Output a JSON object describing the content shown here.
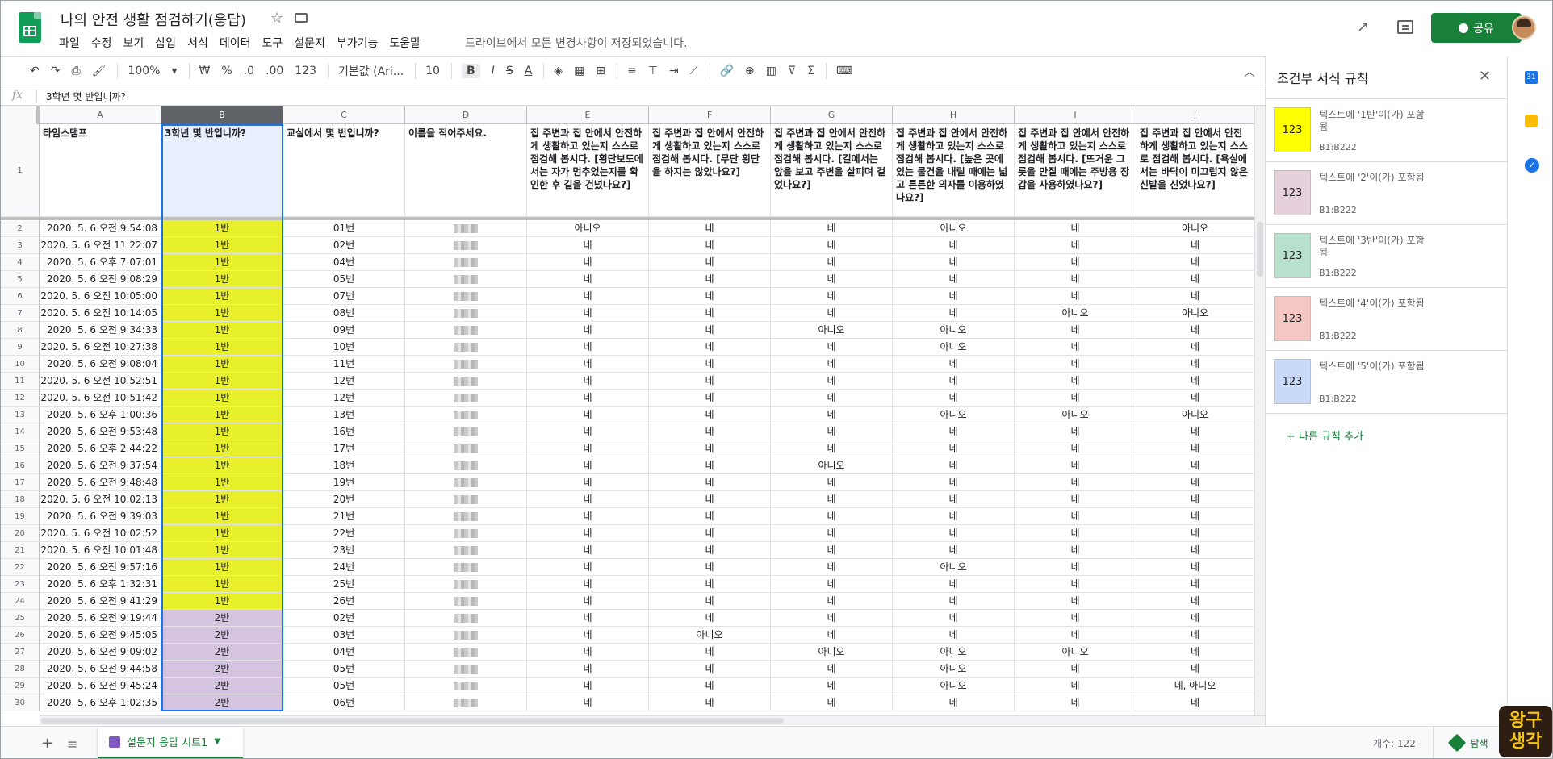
{
  "doc": {
    "title": "나의 안전 생활 점검하기(응답)",
    "menu": [
      "파일",
      "수정",
      "보기",
      "삽입",
      "서식",
      "데이터",
      "도구",
      "설문지",
      "부가기능",
      "도움말"
    ],
    "save_status": "드라이브에서 모든 변경사항이 저장되었습니다.",
    "share_label": "공유"
  },
  "toolbar": {
    "zoom": "100%",
    "currency": "₩",
    "percent": "%",
    "dec_dec": ".0",
    "dec_inc": ".00",
    "format": "123",
    "font": "기본값 (Ari...",
    "size": "10",
    "bold": "B",
    "italic": "I",
    "strike": "S",
    "text_color": "A",
    "sum": "Σ"
  },
  "formula": {
    "fx": "fx",
    "value": "3학년 몇 반입니까?"
  },
  "columns": [
    "A",
    "B",
    "C",
    "D",
    "E",
    "F",
    "G",
    "H",
    "I",
    "J"
  ],
  "header_row": [
    "타임스탬프",
    "3학년 몇 반입니까?",
    "교실에서 몇 번입니까?",
    "이름을 적어주세요.",
    "집 주변과 집 안에서 안전하게 생활하고 있는지 스스로 점검해 봅시다. [횡단보도에서는 자가 멈추었는지를 확인한 후 길을 건넜나요?]",
    "집 주변과 집 안에서 안전하게 생활하고 있는지 스스로 점검해 봅시다. [무단 횡단을 하지는 않았나요?]",
    "집 주변과 집 안에서 안전하게 생활하고 있는지 스스로 점검해 봅시다. [길에서는 앞을 보고 주변을 살피며 걸었나요?]",
    "집 주변과 집 안에서 안전하게 생활하고 있는지 스스로 점검해 봅시다. [높은 곳에 있는 물건을 내릴 때에는 넓고 튼튼한 의자를 이용하였나요?]",
    "집 주변과 집 안에서 안전하게 생활하고 있는지 스스로 점검해 봅시다. [뜨거운 그릇을 만질 때에는 주방용 장갑을 사용하였나요?]",
    "집 주변과 집 안에서 안전하게 생활하고 있는지 스스로 점검해 봅시다. [욕실에서는 바닥이 미끄럽지 않은 신발을 신었나요?]"
  ],
  "rows": [
    [
      "2",
      "2020. 5. 6 오전 9:54:08",
      "1반",
      "01번",
      "아니오",
      "네",
      "네",
      "아니오",
      "네",
      "아니오"
    ],
    [
      "3",
      "2020. 5. 6 오전 11:22:07",
      "1반",
      "02번",
      "네",
      "네",
      "네",
      "네",
      "네",
      "네"
    ],
    [
      "4",
      "2020. 5. 6 오후 7:07:01",
      "1반",
      "04번",
      "네",
      "네",
      "네",
      "네",
      "네",
      "네"
    ],
    [
      "5",
      "2020. 5. 6 오전 9:08:29",
      "1반",
      "05번",
      "네",
      "네",
      "네",
      "네",
      "네",
      "네"
    ],
    [
      "6",
      "2020. 5. 6 오전 10:05:00",
      "1반",
      "07번",
      "네",
      "네",
      "네",
      "네",
      "네",
      "네"
    ],
    [
      "7",
      "2020. 5. 6 오전 10:14:05",
      "1반",
      "08번",
      "네",
      "네",
      "네",
      "네",
      "아니오",
      "아니오"
    ],
    [
      "8",
      "2020. 5. 6 오전 9:34:33",
      "1반",
      "09번",
      "네",
      "네",
      "아니오",
      "아니오",
      "네",
      "네"
    ],
    [
      "9",
      "2020. 5. 6 오전 10:27:38",
      "1반",
      "10번",
      "네",
      "네",
      "네",
      "아니오",
      "네",
      "네"
    ],
    [
      "10",
      "2020. 5. 6 오전 9:08:04",
      "1반",
      "11번",
      "네",
      "네",
      "네",
      "네",
      "네",
      "네"
    ],
    [
      "11",
      "2020. 5. 6 오전 10:52:51",
      "1반",
      "12번",
      "네",
      "네",
      "네",
      "네",
      "네",
      "네"
    ],
    [
      "12",
      "2020. 5. 6 오전 10:51:42",
      "1반",
      "12번",
      "네",
      "네",
      "네",
      "네",
      "네",
      "네"
    ],
    [
      "13",
      "2020. 5. 6 오후 1:00:36",
      "1반",
      "13번",
      "네",
      "네",
      "네",
      "아니오",
      "아니오",
      "아니오"
    ],
    [
      "14",
      "2020. 5. 6 오전 9:53:48",
      "1반",
      "16번",
      "네",
      "네",
      "네",
      "네",
      "네",
      "네"
    ],
    [
      "15",
      "2020. 5. 6 오후 2:44:22",
      "1반",
      "17번",
      "네",
      "네",
      "네",
      "네",
      "네",
      "네"
    ],
    [
      "16",
      "2020. 5. 6 오전 9:37:54",
      "1반",
      "18번",
      "네",
      "네",
      "아니오",
      "네",
      "네",
      "네"
    ],
    [
      "17",
      "2020. 5. 6 오전 9:48:48",
      "1반",
      "19번",
      "네",
      "네",
      "네",
      "네",
      "네",
      "네"
    ],
    [
      "18",
      "2020. 5. 6 오전 10:02:13",
      "1반",
      "20번",
      "네",
      "네",
      "네",
      "네",
      "네",
      "네"
    ],
    [
      "19",
      "2020. 5. 6 오전 9:39:03",
      "1반",
      "21번",
      "네",
      "네",
      "네",
      "네",
      "네",
      "네"
    ],
    [
      "20",
      "2020. 5. 6 오전 10:02:52",
      "1반",
      "22번",
      "네",
      "네",
      "네",
      "네",
      "네",
      "네"
    ],
    [
      "21",
      "2020. 5. 6 오전 10:01:48",
      "1반",
      "23번",
      "네",
      "네",
      "네",
      "네",
      "네",
      "네"
    ],
    [
      "22",
      "2020. 5. 6 오전 9:57:16",
      "1반",
      "24번",
      "네",
      "네",
      "네",
      "아니오",
      "네",
      "네"
    ],
    [
      "23",
      "2020. 5. 6 오후 1:32:31",
      "1반",
      "25번",
      "네",
      "네",
      "네",
      "네",
      "네",
      "네"
    ],
    [
      "24",
      "2020. 5. 6 오전 9:41:29",
      "1반",
      "26번",
      "네",
      "네",
      "네",
      "네",
      "네",
      "네"
    ],
    [
      "25",
      "2020. 5. 6 오전 9:19:44",
      "2반",
      "02번",
      "네",
      "네",
      "네",
      "네",
      "네",
      "네"
    ],
    [
      "26",
      "2020. 5. 6 오전 9:45:05",
      "2반",
      "03번",
      "네",
      "아니오",
      "네",
      "네",
      "네",
      "네"
    ],
    [
      "27",
      "2020. 5. 6 오전 9:09:02",
      "2반",
      "04번",
      "네",
      "네",
      "아니오",
      "아니오",
      "아니오",
      "네"
    ],
    [
      "28",
      "2020. 5. 6 오전 9:44:58",
      "2반",
      "05번",
      "네",
      "네",
      "네",
      "아니오",
      "네",
      "네"
    ],
    [
      "29",
      "2020. 5. 6 오전 9:45:24",
      "2반",
      "05번",
      "네",
      "네",
      "네",
      "아니오",
      "네",
      "네, 아니오"
    ],
    [
      "30",
      "2020. 5. 6 오후 1:02:35",
      "2반",
      "06번",
      "네",
      "네",
      "네",
      "네",
      "네",
      "네"
    ]
  ],
  "colors": {
    "class1": "#e8f02c",
    "class2": "#d5c4df",
    "accent": "#188038",
    "selection": "#1a73e8"
  },
  "sidebar": {
    "title": "조건부 서식 규칙",
    "rules": [
      {
        "swatch": "123",
        "text": "텍스트에 '1반'이(가) 포함됨",
        "range": "B1:B222",
        "color": "#ffff00"
      },
      {
        "swatch": "123",
        "text": "텍스트에 '2'이(가) 포함됨",
        "range": "B1:B222",
        "color": "#e6d0dc"
      },
      {
        "swatch": "123",
        "text": "텍스트에 '3반'이(가) 포함됨",
        "range": "B1:B222",
        "color": "#b7e1cd"
      },
      {
        "swatch": "123",
        "text": "텍스트에 '4'이(가) 포함됨",
        "range": "B1:B222",
        "color": "#f4c7c3"
      },
      {
        "swatch": "123",
        "text": "텍스트에 '5'이(가) 포함됨",
        "range": "B1:B222",
        "color": "#c9daf8"
      }
    ],
    "add_rule": "+ 다른 규칙 추가"
  },
  "rail": {
    "calendar": "31",
    "tasks": "✓"
  },
  "bottom": {
    "sheet_name": "설문지 응답 시트1",
    "count": "개수: 122",
    "explore": "탐색"
  },
  "watermark": {
    "line1": "왕구",
    "line2": "생각"
  }
}
